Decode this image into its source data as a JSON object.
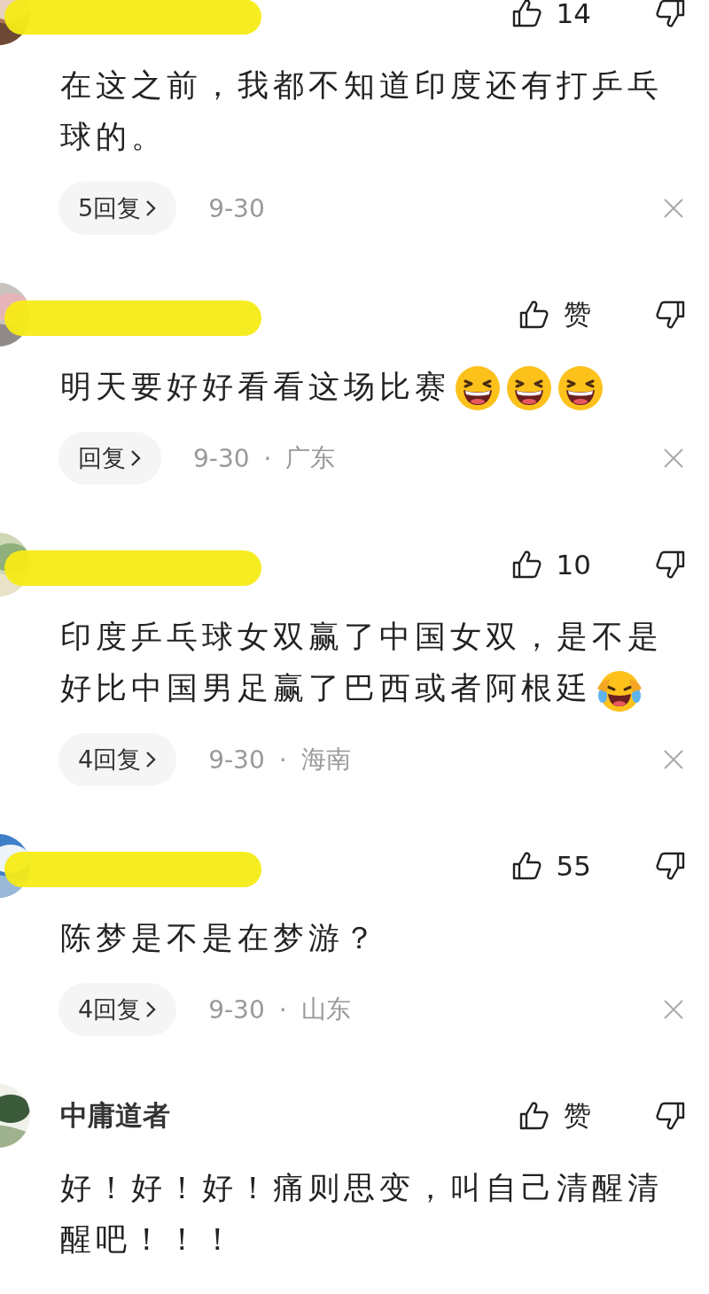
{
  "comments": [
    {
      "name_hidden": true,
      "likes": "14",
      "content": [
        {
          "kind": "text",
          "text": "在这之前，我都不知道印度还有打乒乓球的。"
        }
      ],
      "reply": "5回复",
      "date": "9-30"
    },
    {
      "name_hidden": true,
      "likes": "赞",
      "content": [
        {
          "kind": "text",
          "text": "明天要好好看看这场比赛"
        },
        {
          "kind": "grin"
        },
        {
          "kind": "grin"
        },
        {
          "kind": "grin"
        }
      ],
      "reply": "回复",
      "date": "9-30",
      "separator": "·",
      "region": "广东"
    },
    {
      "name_hidden": true,
      "likes": "10",
      "content": [
        {
          "kind": "text",
          "text": "印度乒乓球女双赢了中国女双，是不是好比中国男足赢了巴西或者阿根廷"
        },
        {
          "kind": "rofl"
        }
      ],
      "reply": "4回复",
      "date": "9-30",
      "separator": "·",
      "region": "海南"
    },
    {
      "name_hidden": true,
      "likes": "55",
      "content": [
        {
          "kind": "text",
          "text": "陈梦是不是在梦游？"
        }
      ],
      "reply": "4回复",
      "date": "9-30",
      "separator": "·",
      "region": "山东"
    },
    {
      "name_hidden": false,
      "name": "中庸道者",
      "likes": "赞",
      "content": [
        {
          "kind": "text",
          "text": "好！好！好！痛则思变，叫自己清醒清醒吧！！！"
        }
      ]
    }
  ]
}
